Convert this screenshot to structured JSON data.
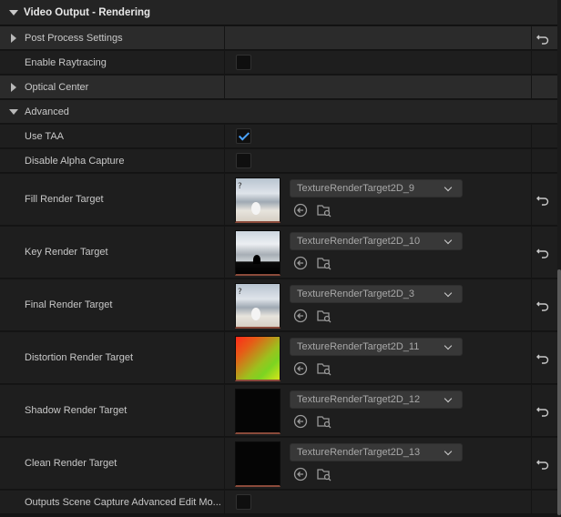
{
  "section": {
    "title": "Video Output - Rendering"
  },
  "rows": {
    "post_process": {
      "label": "Post Process Settings"
    },
    "enable_raytracing": {
      "label": "Enable Raytracing",
      "checked": false
    },
    "optical_center": {
      "label": "Optical Center"
    },
    "advanced": {
      "label": "Advanced"
    },
    "use_taa": {
      "label": "Use TAA",
      "checked": true
    },
    "disable_alpha": {
      "label": "Disable Alpha Capture",
      "checked": false
    },
    "fill_rt": {
      "label": "Fill Render Target",
      "texture": "TextureRenderTarget2D_9"
    },
    "key_rt": {
      "label": "Key Render Target",
      "texture": "TextureRenderTarget2D_10"
    },
    "final_rt": {
      "label": "Final Render Target",
      "texture": "TextureRenderTarget2D_3"
    },
    "distortion_rt": {
      "label": "Distortion Render Target",
      "texture": "TextureRenderTarget2D_11"
    },
    "shadow_rt": {
      "label": "Shadow Render Target",
      "texture": "TextureRenderTarget2D_12"
    },
    "clean_rt": {
      "label": "Clean Render Target",
      "texture": "TextureRenderTarget2D_13"
    },
    "outputs_scene": {
      "label": "Outputs Scene Capture Advanced Edit Mo...",
      "checked": false
    }
  },
  "icons": {
    "reset": "reset-to-default-icon",
    "use_selected": "use-selected-asset-icon",
    "browse": "browse-to-asset-icon"
  },
  "colors": {
    "check_accent": "#4aa3ff",
    "row_bg": "#1e1e1e",
    "category_bg": "#2b2b2b"
  }
}
